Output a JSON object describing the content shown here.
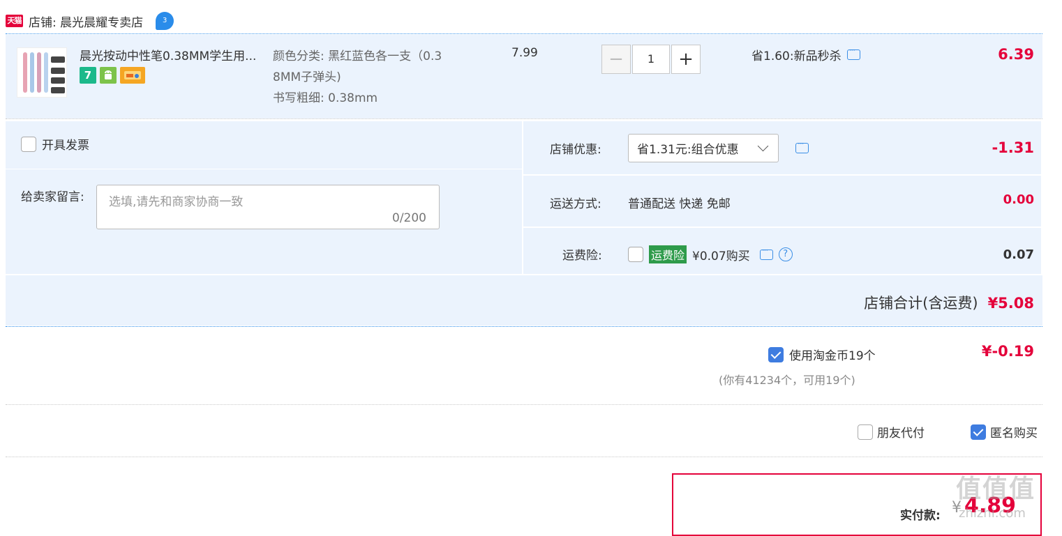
{
  "store": {
    "badge": "天猫",
    "name": "店铺: 晨光晨耀专卖店",
    "drop_icon": "water-drop-icon"
  },
  "item": {
    "title": "晨光按动中性笔0.38MM学生用...",
    "attr_color": "颜色分类: 黑红蓝色各一支（0.3",
    "attr_color_2": "8MM子弹头)",
    "attr_width": "书写粗细: 0.38mm",
    "unit_price": "7.99",
    "quantity": "1",
    "promo": "省1.60:新品秒杀",
    "total": "6.39",
    "service_icons": [
      "seven-day-return-icon",
      "android-icon",
      "card-icon"
    ],
    "service_7": "7"
  },
  "invoice": {
    "label": "开具发票",
    "checked": false
  },
  "message": {
    "label": "给卖家留言:",
    "placeholder": "选填,请先和商家协商一致",
    "counter": "0/200"
  },
  "store_discount": {
    "label": "店铺优惠:",
    "selected": "省1.31元:组合优惠",
    "value": "-1.31"
  },
  "shipping": {
    "label": "运送方式:",
    "method": "普通配送 快递 免邮",
    "fee": "0.00"
  },
  "insurance": {
    "label": "运费险:",
    "badge": "运费险",
    "price_text": "¥0.07购买",
    "help": "?",
    "fee": "0.07"
  },
  "store_total": {
    "label": "店铺合计(含运费)",
    "amount": "¥5.08"
  },
  "coins": {
    "label": "使用淘金币19个",
    "note": "(你有41234个，可用19个)",
    "value": "¥-0.19",
    "checked": true
  },
  "options": {
    "friend_pay": "朋友代付",
    "anonymous": "匿名购买"
  },
  "payment": {
    "label": "实付款:",
    "currency": "¥",
    "amount": "4.89"
  },
  "watermark": {
    "text": "值值值",
    "site": "zhizhi.com"
  },
  "colors": {
    "accent_red": "#e4003a",
    "row_blue": "#ebf3fd",
    "checkbox_blue": "#3e7ce0",
    "insurance_green": "#2e9b4a"
  }
}
